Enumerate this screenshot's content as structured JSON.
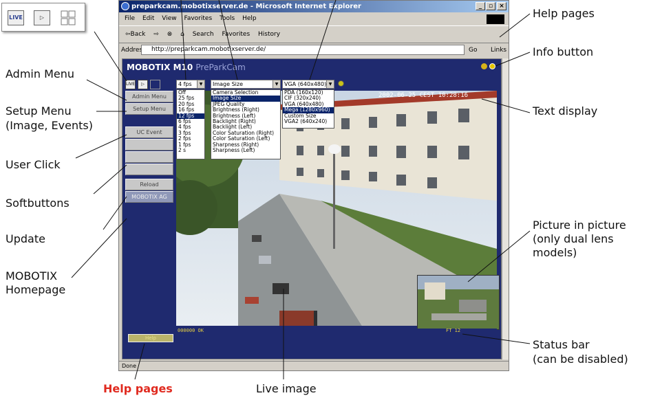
{
  "callouts": {
    "help_pages_top": "Help pages",
    "info_button": "Info button",
    "admin_menu": "Admin Menu",
    "setup_menu_1": "Setup Menu",
    "setup_menu_2": "(Image, Events)",
    "user_click": "User Click",
    "softbuttons": "Softbuttons",
    "update": "Update",
    "mobotix_homepage_1": "MOBOTIX",
    "mobotix_homepage_2": "Homepage",
    "text_display": "Text display",
    "pip_1": "Picture in picture",
    "pip_2": "(only dual lens",
    "pip_3": "models)",
    "status_bar_1": "Status bar",
    "status_bar_2": "(can be disabled)",
    "help_pages_bottom": "Help pages",
    "live_image": "Live image"
  },
  "inset_buttons": [
    "LIVE",
    "▷",
    ""
  ],
  "browser": {
    "title": "preparkcam.mobotixserver.de - Microsoft Internet Explorer",
    "menu": [
      "File",
      "Edit",
      "View",
      "Favorites",
      "Tools",
      "Help"
    ],
    "toolbar": [
      "⇦Back",
      "⇨",
      "⊗",
      "⌂",
      "Search",
      "Favorites",
      "History"
    ],
    "address_label": "Address",
    "address": "http://preparkcam.mobotixserver.de/",
    "go": "Go",
    "links": "Links",
    "status": "Done"
  },
  "page": {
    "brand": "MOBOTIX M10",
    "camera_name": "PreParkCam",
    "side_buttons": [
      "Admin Menu",
      "Setup Menu",
      "UC Event",
      "",
      "",
      "",
      "Reload",
      "MOBOTIX AG"
    ],
    "fps_select": "4 fps",
    "fps_options": [
      "Off",
      "25 fps",
      "20 fps",
      "16 fps",
      "12 fps",
      "6 fps",
      "4 fps",
      "3 fps",
      "2 fps",
      "1 fps",
      "2 s"
    ],
    "fps_selected_index": 4,
    "config_select": "Image Size",
    "config_options": [
      "Camera Selection",
      "Image Size",
      "JPEG Quality",
      "Brightness (Right)",
      "Brightness (Left)",
      "Backlight (Right)",
      "Backlight (Left)",
      "Color Saturation (Right)",
      "Color Saturation (Left)",
      "Sharpness (Right)",
      "Sharpness (Left)"
    ],
    "config_selected_index": 1,
    "size_select": "VGA (640x480)",
    "size_options": [
      "PDA (160x120)",
      "CIF (320x240)",
      "VGA (640x480)",
      "Mega (1280x960)",
      "Custom Size",
      "VGA2 (640x240)"
    ],
    "size_selected_index": 3,
    "timestamp": "2002-06-25 CEST 10:28:16",
    "status_left": "000000 OK",
    "status_right": "FT 12",
    "help_button": "Help"
  }
}
